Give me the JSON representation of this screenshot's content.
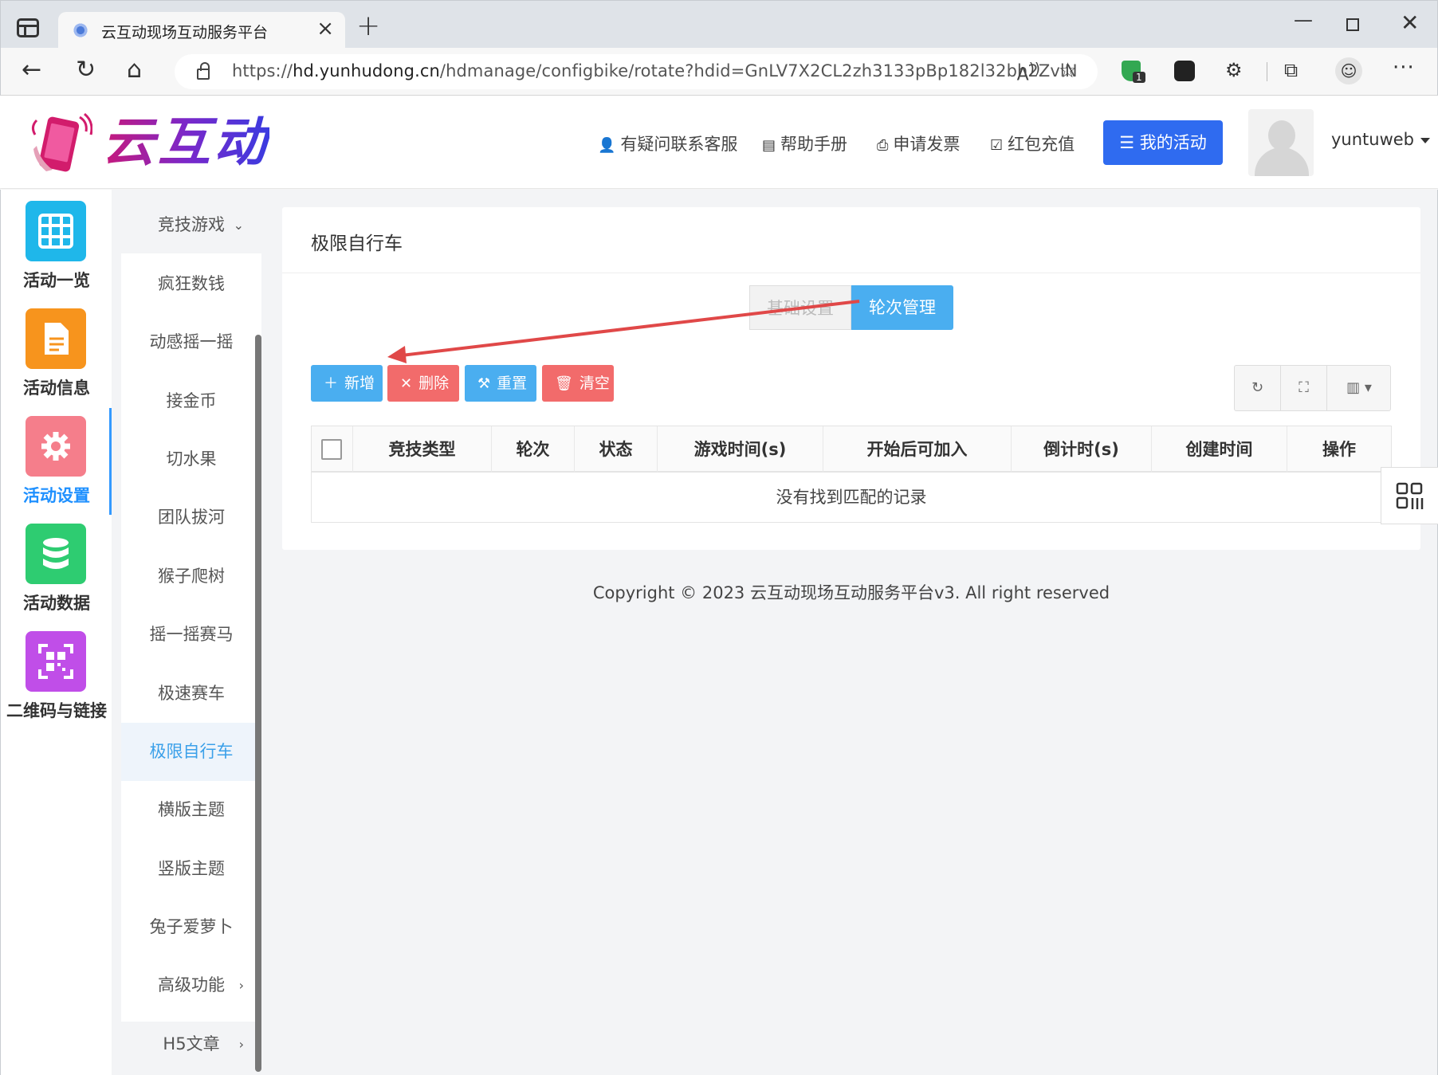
{
  "browser": {
    "tab_title": "云互动现场互动服务平台",
    "url_prefix": "https://",
    "url_host": "hd.yunhudong.cn",
    "url_path": "/hdmanage/configbike/rotate?hdid=GnLV7X2CL2zh3133pBp182l32bh2ZvlN",
    "extension_badge": "1"
  },
  "header": {
    "logo_text": "云互动",
    "links": {
      "support": "有疑问联系客服",
      "help": "帮助手册",
      "invoice": "申请发票",
      "recharge": "红包充值"
    },
    "my_activities": "我的活动",
    "username": "yuntuweb"
  },
  "rail": {
    "items": [
      {
        "label": "活动一览",
        "icon": "grid-icon",
        "color": "#1fb7ea"
      },
      {
        "label": "活动信息",
        "icon": "document-icon",
        "color": "#f7941d"
      },
      {
        "label": "活动设置",
        "icon": "gear-icon",
        "color": "#f57e8b"
      },
      {
        "label": "活动数据",
        "icon": "database-icon",
        "color": "#2ecc71"
      },
      {
        "label": "二维码与链接",
        "icon": "qrcode-icon",
        "color": "#c04ee8"
      }
    ],
    "active_index": 2
  },
  "submenu": {
    "group_top": "竞技游戏",
    "items": [
      "疯狂数钱",
      "动感摇一摇",
      "接金币",
      "切水果",
      "团队拔河",
      "猴子爬树",
      "摇一摇赛马",
      "极速赛车",
      "极限自行车",
      "横版主题",
      "竖版主题",
      "兔子爱萝卜"
    ],
    "active": "极限自行车",
    "group_advanced": "高级功能",
    "group_h5": "H5文章"
  },
  "main": {
    "title": "极限自行车",
    "tabs": {
      "basic": "基础设置",
      "rounds": "轮次管理"
    },
    "toolbar": {
      "add": "新增",
      "delete": "删除",
      "reset": "重置",
      "clear": "清空"
    },
    "table": {
      "columns": [
        "竞技类型",
        "轮次",
        "状态",
        "游戏时间(s)",
        "开始后可加入",
        "倒计时(s)",
        "创建时间",
        "操作"
      ],
      "empty_text": "没有找到匹配的记录"
    },
    "copyright": "Copyright © 2023 云互动现场互动服务平台v3. All right reserved"
  },
  "colors": {
    "primary": "#2f6bf0",
    "info": "#4aaef0",
    "danger": "#f26b6b",
    "annotation_arrow": "#e04848"
  }
}
